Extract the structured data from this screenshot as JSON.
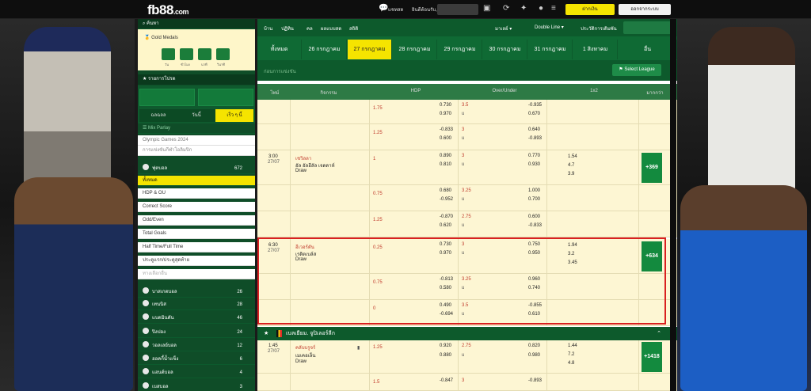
{
  "header": {
    "logo_main": "fb88",
    "logo_suffix": ".com",
    "chat_label": "แชทสด",
    "welcome": "ยินดีต้อนรับ,",
    "deposit_label": "ฝากเงิน",
    "logout_label": "ออกจากระบบ"
  },
  "sidebar": {
    "search_label": "ค้นหา",
    "gold_title": "Gold Medals",
    "countdown_labels": [
      "วัน",
      "ชั่วโมง",
      "นาที",
      "วินาที"
    ],
    "fav_label": "รายการโปรด",
    "tabs": [
      "ฉลฉลล",
      "วันนี้",
      "เร็ว ๆ นี้"
    ],
    "mix_parlay": "Mix Parlay",
    "olympic": "Olympic Games 2024",
    "olympic_sub": "การแข่งขันกีฬาโอลิมปิก",
    "football": "ฟุตบอล",
    "football_count": "672",
    "markets": [
      "ทั้งหมด",
      "HDP & OU",
      "Correct Score",
      "Odd/Even",
      "Total Goals",
      "Half Time/Full Time",
      "ประตูแรก/ประตูสุดท้าย",
      "ทางเลือกอื่น"
    ],
    "sports": [
      {
        "name": "บาสเกตบอล",
        "count": "26"
      },
      {
        "name": "เทนนิส",
        "count": "28"
      },
      {
        "name": "แบดมินตัน",
        "count": "46"
      },
      {
        "name": "ปิงปอง",
        "count": "24"
      },
      {
        "name": "วอลเลย์บอล",
        "count": "12"
      },
      {
        "name": "ฮอคกี้น้ำแข็ง",
        "count": "6"
      },
      {
        "name": "แฮนด์บอล",
        "count": "4"
      },
      {
        "name": "เบสบอล",
        "count": "3"
      }
    ]
  },
  "nav": {
    "links": [
      "บ้าน",
      "ปฏิทิน",
      "คล",
      "ผลแบบสด",
      "สถิติ"
    ],
    "lang": "มาเลย์ ▾",
    "odds_type": "Double Line ▾",
    "history": "ประวัติการเดิมพัน",
    "dates": [
      "ทั้งหมด",
      "26 กรกฎาคม",
      "27 กรกฎาคม",
      "28 กรกฎาคม",
      "29 กรกฎาคม",
      "30 กรกฎาคม",
      "31 กรกฎาคม",
      "1 สิงหาคม",
      "อื่น"
    ],
    "filter_label": "ก่อนการแข่งขัน",
    "select_league": "Select League"
  },
  "table": {
    "headers": [
      "ไทม์",
      "กิจกรรม",
      "HDP",
      "Over/Under",
      "1x2",
      "มากกว่า"
    ],
    "rows": [
      {
        "time": "",
        "date": "",
        "teams": [],
        "more": "",
        "subrows": [
          {
            "hdp_l": "1.75",
            "hdp": [
              "0.730",
              "0.970"
            ],
            "ou_l": [
              "3.5",
              "u"
            ],
            "ou": [
              "-0.935",
              "0.670"
            ],
            "x12": []
          },
          {
            "hdp_l": "1.25",
            "hdp": [
              "-0.833",
              "0.600"
            ],
            "ou_l": [
              "3",
              "u"
            ],
            "ou": [
              "0.640",
              "-0.893"
            ],
            "x12": []
          }
        ]
      },
      {
        "time": "3:00",
        "date": "27/07",
        "teams": [
          "เชวิลลา",
          "อัล อัลฮีลัล เจดดาห์",
          "Draw"
        ],
        "more": "+369",
        "subrows": [
          {
            "hdp_l": "1",
            "hdp": [
              "0.890",
              "0.810"
            ],
            "ou_l": [
              "3",
              "u"
            ],
            "ou": [
              "0.770",
              "0.930"
            ],
            "x12": [
              "1.54",
              "4.7",
              "3.9"
            ]
          },
          {
            "hdp_l": "0.75",
            "hdp": [
              "0.680",
              "-0.952"
            ],
            "ou_l": [
              "3.25",
              "u"
            ],
            "ou": [
              "1.000",
              "0.700"
            ],
            "x12": []
          },
          {
            "hdp_l": "1.25",
            "hdp": [
              "-0.870",
              "0.620"
            ],
            "ou_l": [
              "2.75",
              "u"
            ],
            "ou": [
              "0.600",
              "-0.833"
            ],
            "x12": []
          }
        ]
      },
      {
        "time": "6:30",
        "date": "27/07",
        "teams": [
          "อีเวอร์ตัน",
          "เรดิตเบล์ส",
          "Draw"
        ],
        "more": "+634",
        "subrows": [
          {
            "hdp_l": "0.25",
            "hdp": [
              "0.730",
              "0.970"
            ],
            "ou_l": [
              "3",
              "u"
            ],
            "ou": [
              "0.750",
              "0.950"
            ],
            "x12": [
              "1.94",
              "3.2",
              "3.45"
            ]
          },
          {
            "hdp_l": "0.75",
            "hdp": [
              "-0.813",
              "0.580"
            ],
            "ou_l": [
              "3.25",
              "u"
            ],
            "ou": [
              "0.960",
              "0.740"
            ],
            "x12": []
          },
          {
            "hdp_l": "0",
            "hdp": [
              "0.490",
              "-0.694"
            ],
            "ou_l": [
              "3.5",
              "u"
            ],
            "ou": [
              "-0.855",
              "0.610"
            ],
            "x12": []
          }
        ]
      }
    ],
    "league": "เบลเยียม. จูปิเลอร์ลีก",
    "match4": {
      "time": "1:45",
      "date": "27/07",
      "teams": [
        "คลับบรูจร์",
        "เมเคอเล็น",
        "Draw"
      ],
      "more": "+1418",
      "hdp_l": "1.25",
      "hdp": [
        "0.920",
        "0.880"
      ],
      "ou_l": [
        "2.75",
        "u"
      ],
      "ou": [
        "0.820",
        "0.980"
      ],
      "x12": [
        "1.44",
        "7.2",
        "4.8"
      ],
      "hdp_l2": "1.5",
      "hdp2": [
        "-0.847"
      ],
      "ou_l2": [
        "3"
      ],
      "ou2": [
        "-0.893"
      ]
    }
  }
}
